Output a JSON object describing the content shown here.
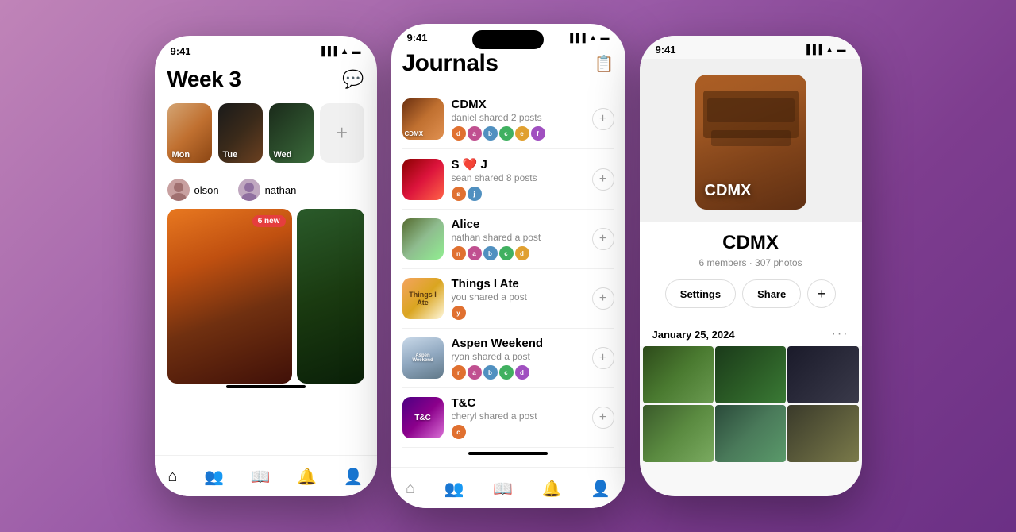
{
  "background": "purple-gradient",
  "phone1": {
    "status_time": "9:41",
    "title": "Week 3",
    "chat_icon": "💬",
    "days": [
      {
        "label": "Mon",
        "color": "day-mon"
      },
      {
        "label": "Tue",
        "color": "day-tue"
      },
      {
        "label": "Wed",
        "color": "day-wed"
      }
    ],
    "add_label": "+",
    "friends": [
      {
        "name": "olson"
      },
      {
        "name": "nathan"
      }
    ],
    "new_badge": "6 new",
    "nav_items": [
      "home",
      "people",
      "book",
      "bell",
      "person"
    ]
  },
  "phone2": {
    "status_time": "9:41",
    "title": "Journals",
    "journals": [
      {
        "id": "cdmx",
        "name": "CDMX",
        "subtitle": "daniel shared 2 posts",
        "thumb_class": "j-cdmx",
        "avatars": [
          "#e07030",
          "#c05090",
          "#5090c0",
          "#40b060",
          "#e0a030",
          "#a050c0"
        ]
      },
      {
        "id": "sj",
        "name": "S ❤ J",
        "subtitle": "sean shared 8 posts",
        "thumb_class": "j-sj",
        "avatars": [
          "#e07030",
          "#5090c0"
        ]
      },
      {
        "id": "alice",
        "name": "Alice",
        "subtitle": "nathan shared a post",
        "thumb_class": "j-alice",
        "avatars": [
          "#e07030",
          "#c05090",
          "#5090c0",
          "#40b060",
          "#e0a030"
        ]
      },
      {
        "id": "things",
        "name": "Things I Ate",
        "subtitle": "you shared a post",
        "thumb_class": "j-things",
        "avatars": [
          "#e07030"
        ]
      },
      {
        "id": "aspen",
        "name": "Aspen Weekend",
        "subtitle": "ryan shared a post",
        "thumb_class": "j-aspen",
        "avatars": [
          "#e07030",
          "#c05090",
          "#5090c0",
          "#40b060",
          "#a050c0"
        ]
      },
      {
        "id": "tc",
        "name": "T&C",
        "subtitle": "cheryl shared a post",
        "thumb_class": "j-tc",
        "avatars": [
          "#e07030"
        ]
      }
    ],
    "nav_items": [
      "home",
      "people",
      "book",
      "bell",
      "person"
    ]
  },
  "phone3": {
    "status_time": "9:41",
    "journal_name": "CDMX",
    "journal_cover_label": "CDMX",
    "members": "6 members",
    "photos": "307 photos",
    "meta": "6 members · 307 photos",
    "settings_label": "Settings",
    "share_label": "Share",
    "add_icon": "+",
    "date_label": "January 25, 2024",
    "more_icon": "···",
    "photos_grid": [
      "cp1",
      "cp2",
      "cp3",
      "cp4",
      "cp5",
      "cp6"
    ]
  }
}
